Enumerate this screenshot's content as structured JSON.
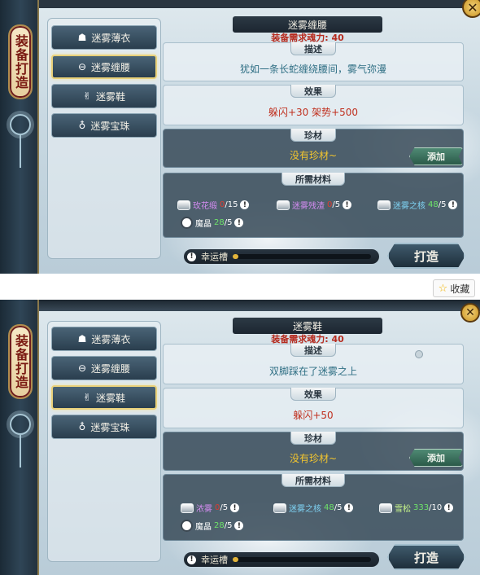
{
  "common": {
    "banner_text": "装备打造",
    "nav": [
      {
        "icon": "☗",
        "label": "迷雾薄衣"
      },
      {
        "icon": "⊖",
        "label": "迷雾缠腰"
      },
      {
        "icon": "✌",
        "label": "迷雾鞋"
      },
      {
        "icon": "♁",
        "label": "迷雾宝珠"
      }
    ],
    "headers": {
      "desc": "描述",
      "effect": "效果",
      "rare": "珍材",
      "materials": "所需材料"
    },
    "add_label": "添加",
    "luck_label": "幸运槽",
    "craft_label": "打造",
    "close": "✕"
  },
  "panel1": {
    "active_nav": 1,
    "item_name": "迷雾缠腰",
    "requirement": "装备需求魂力: 40",
    "description": "犹如一条长蛇缠绕腰间，雾气弥漫",
    "effect": "躲闪+30  架势+500",
    "rare": "没有珍材~",
    "luck_percent": 4,
    "materials": [
      {
        "name": "玫花缎",
        "have": "0",
        "need": "/15",
        "color": "pink",
        "have_ok": false
      },
      {
        "name": "迷雾残渣",
        "have": "0",
        "need": "/5",
        "color": "pink",
        "have_ok": false
      },
      {
        "name": "迷雾之核",
        "have": "48",
        "need": "/5",
        "color": "blue",
        "have_ok": true
      },
      {
        "name": "魔晶",
        "have": "28",
        "need": "/5",
        "color": "white",
        "have_ok": true
      }
    ]
  },
  "panel2": {
    "active_nav": 2,
    "item_name": "迷雾鞋",
    "requirement": "装备需求魂力: 40",
    "description": "双脚踩在了迷雾之上",
    "effect": "躲闪+50",
    "rare": "没有珍材~",
    "luck_percent": 4,
    "materials": [
      {
        "name": "浓雾",
        "have": "0",
        "need": "/5",
        "color": "pink",
        "have_ok": false
      },
      {
        "name": "迷雾之核",
        "have": "48",
        "need": "/5",
        "color": "blue",
        "have_ok": true
      },
      {
        "name": "雪松",
        "have": "333",
        "need": "/10",
        "color": "green",
        "have_ok": true
      },
      {
        "name": "魔晶",
        "have": "28",
        "need": "/5",
        "color": "white",
        "have_ok": true
      }
    ]
  },
  "favorite": {
    "icon": "☆",
    "label": "收藏"
  },
  "colors": {
    "red": "#b62b1f",
    "gold": "#f2c52e",
    "teal": "#2f6f84"
  }
}
